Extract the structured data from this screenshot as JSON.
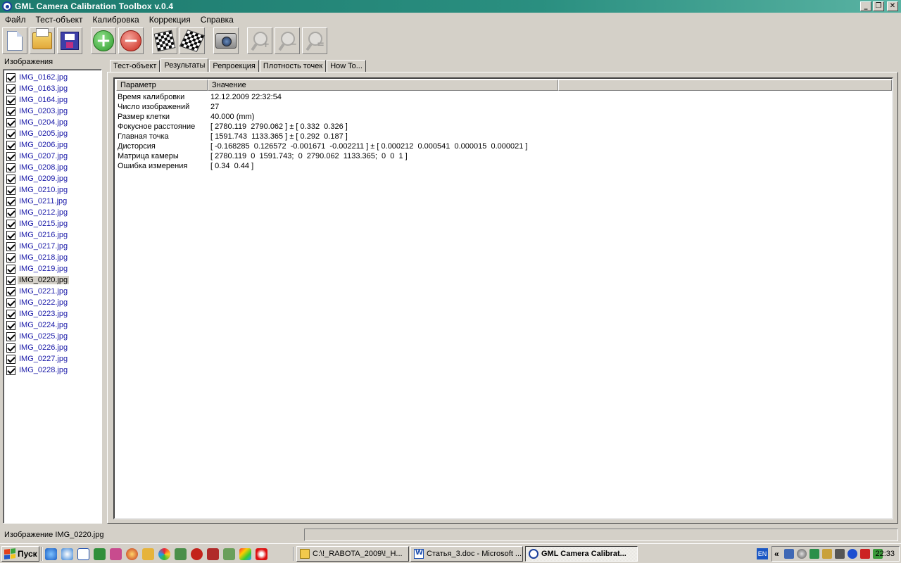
{
  "window": {
    "title": "GML Camera Calibration Toolbox  v.0.4",
    "minimize_glyph": "_",
    "restore_glyph": "❐",
    "close_glyph": "✕"
  },
  "menu": [
    "Файл",
    "Тест-объект",
    "Калибровка",
    "Коррекция",
    "Справка"
  ],
  "toolbar": {
    "zoom_in_sign": "+",
    "zoom_out_sign": "−",
    "zoom_fit_sign": "="
  },
  "images_panel": {
    "label": "Изображения",
    "selected_index": 18,
    "items": [
      "IMG_0162.jpg",
      "IMG_0163.jpg",
      "IMG_0164.jpg",
      "IMG_0203.jpg",
      "IMG_0204.jpg",
      "IMG_0205.jpg",
      "IMG_0206.jpg",
      "IMG_0207.jpg",
      "IMG_0208.jpg",
      "IMG_0209.jpg",
      "IMG_0210.jpg",
      "IMG_0211.jpg",
      "IMG_0212.jpg",
      "IMG_0215.jpg",
      "IMG_0216.jpg",
      "IMG_0217.jpg",
      "IMG_0218.jpg",
      "IMG_0219.jpg",
      "IMG_0220.jpg",
      "IMG_0221.jpg",
      "IMG_0222.jpg",
      "IMG_0223.jpg",
      "IMG_0224.jpg",
      "IMG_0225.jpg",
      "IMG_0226.jpg",
      "IMG_0227.jpg",
      "IMG_0228.jpg"
    ]
  },
  "tabs": {
    "active_index": 1,
    "items": [
      "Тест-объект",
      "Результаты",
      "Репроекция",
      "Плотность точек",
      "How To..."
    ]
  },
  "results": {
    "headers": {
      "param": "Параметр",
      "value": "Значение"
    },
    "rows": [
      {
        "param": "Время калибровки",
        "value": "12.12.2009 22:32:54"
      },
      {
        "param": "Число изображений",
        "value": "27"
      },
      {
        "param": "Размер клетки",
        "value": "40.000 (mm)"
      },
      {
        "param": "Фокусное расстояние",
        "value": "[ 2780.119  2790.062 ] ± [ 0.332  0.326 ]"
      },
      {
        "param": "Главная точка",
        "value": "[ 1591.743  1133.365 ] ± [ 0.292  0.187 ]"
      },
      {
        "param": "Дисторсия",
        "value": "[ -0.168285  0.126572  -0.001671  -0.002211 ] ± [ 0.000212  0.000541  0.000015  0.000021 ]"
      },
      {
        "param": "Матрица камеры",
        "value": "[ 2780.119  0  1591.743;  0  2790.062  1133.365;  0  0  1 ]"
      },
      {
        "param": "Ошибка измерения",
        "value": "[ 0.34  0.44 ]"
      }
    ]
  },
  "statusbar": {
    "text": "Изображение IMG_0220.jpg"
  },
  "taskbar": {
    "start_label": "Пуск",
    "tasks": [
      {
        "label": "C:\\!_RABOTA_2009\\!_H...",
        "icon": "folder-icon"
      },
      {
        "label": "Статья_3.doc - Microsoft ...",
        "icon": "word-icon"
      },
      {
        "label": "GML Camera Calibrat...",
        "icon": "eye-icon"
      }
    ],
    "language": "EN",
    "tray_arrow": "«",
    "clock": "22:33"
  }
}
